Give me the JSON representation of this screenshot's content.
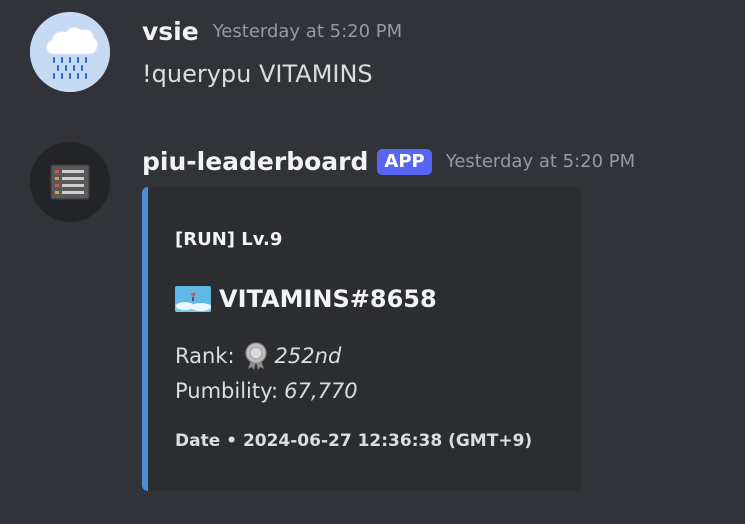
{
  "messages": [
    {
      "username": "vsie",
      "timestamp": "Yesterday at 5:20 PM",
      "content": "!querypu VITAMINS",
      "avatar_icon": "raincloud-icon"
    },
    {
      "username": "piu-leaderboard",
      "badge": "APP",
      "timestamp": "Yesterday at 5:20 PM",
      "avatar_icon": "ledger-icon",
      "embed": {
        "accent_color": "#4a90d9",
        "author": "[RUN] Lv.9",
        "title": "VITAMINS#8658",
        "title_icon": "landscape-thumbnail-icon",
        "rank_label": "Rank:",
        "rank_icon": "medal-icon",
        "rank_value": "252nd",
        "pumbility_label": "Pumbility:",
        "pumbility_value": "67,770",
        "footer": "Date • 2024-06-27 12:36:38 (GMT+9)"
      }
    }
  ],
  "colors": {
    "background": "#313338",
    "embed_background": "#2b2d31",
    "badge": "#5865f2",
    "timestamp": "#949ba4",
    "text": "#dbdee1"
  }
}
